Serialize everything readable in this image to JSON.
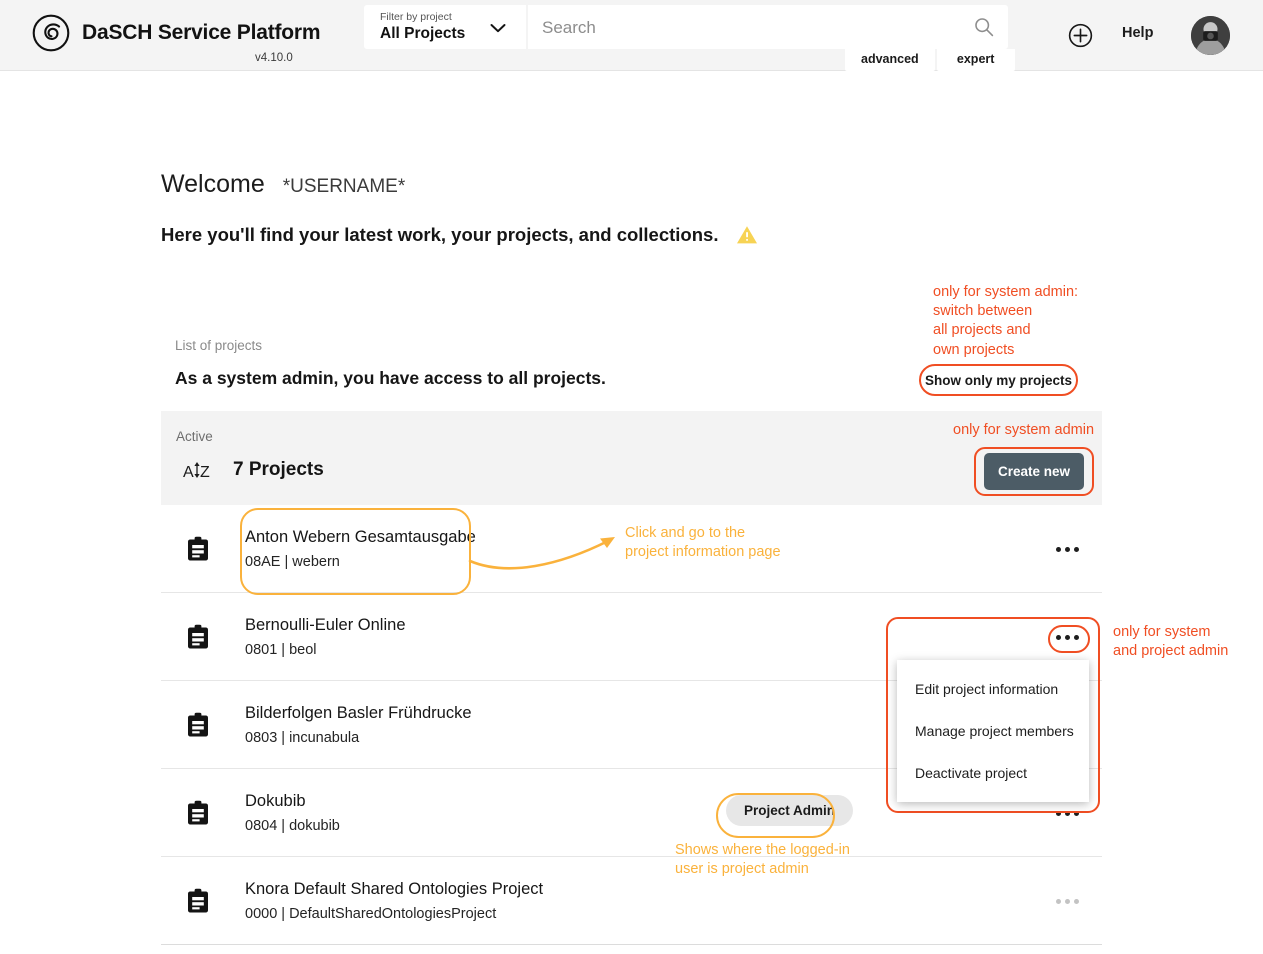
{
  "header": {
    "brand_title": "DaSCH Service Platform",
    "logo_icon": "dasch-logo-icon",
    "version": "v4.10.0",
    "filter": {
      "label": "Filter by project",
      "value": "All Projects",
      "chevron_icon": "chevron-down-icon"
    },
    "search": {
      "placeholder": "Search",
      "value": "",
      "icon": "search-icon",
      "tabs": [
        "advanced",
        "expert"
      ]
    },
    "add_icon": "plus-circle-icon",
    "help_label": "Help",
    "avatar_icon": "user-avatar"
  },
  "main": {
    "welcome_title": "Welcome",
    "welcome_user": "*USERNAME*",
    "subtitle": "Here you'll find your latest work, your projects, and collections.",
    "warning_icon": "warning-triangle-icon",
    "list_label": "List of projects",
    "list_heading": "As a system admin, you have access to all projects.",
    "show_only_my_projects": "Show only my projects",
    "panel": {
      "status_label": "Active",
      "sort_icon": "sort-alpha-icon",
      "count_label": "7 Projects",
      "create_new_label": "Create new"
    },
    "projects": [
      {
        "icon": "clipboard-icon",
        "name": "Anton Webern Gesamtausgabe",
        "meta": "08AE | webern",
        "dots_icon": "more-options-icon",
        "dots_disabled": false,
        "chip": null
      },
      {
        "icon": "clipboard-icon",
        "name": "Bernoulli-Euler Online",
        "meta": "0801 | beol",
        "dots_icon": "more-options-icon",
        "dots_disabled": false,
        "chip": null
      },
      {
        "icon": "clipboard-icon",
        "name": "Bilderfolgen Basler Frühdrucke",
        "meta": "0803 | incunabula",
        "dots_icon": "more-options-icon",
        "dots_disabled": false,
        "chip": null
      },
      {
        "icon": "clipboard-icon",
        "name": "Dokubib",
        "meta": "0804 | dokubib",
        "dots_icon": "more-options-icon",
        "dots_disabled": false,
        "chip": "Project Admin"
      },
      {
        "icon": "clipboard-icon",
        "name": "Knora Default Shared Ontologies Project",
        "meta": "0000 | DefaultSharedOntologiesProject",
        "dots_icon": "more-options-icon",
        "dots_disabled": true,
        "chip": null
      }
    ],
    "context_menu": {
      "items": [
        "Edit project information",
        "Manage project members",
        "Deactivate project"
      ]
    }
  },
  "annotations": {
    "switch_projects": "only for system admin:\nswitch between\nall projects and\nown projects",
    "system_admin_only": "only for system admin",
    "menu_admin": "only for system\nand project admin",
    "click_go": "Click and go to the\nproject information page",
    "project_admin": "Shows where the logged-in\nuser is project admin"
  },
  "colors": {
    "annotation_red": "#f04e23",
    "annotation_orange": "#fab23c",
    "create_new_bg": "#4c5c66",
    "panel_bg": "#f3f3f3",
    "header_bg": "#f4f4f4",
    "warning_yellow": "#f7d354"
  }
}
